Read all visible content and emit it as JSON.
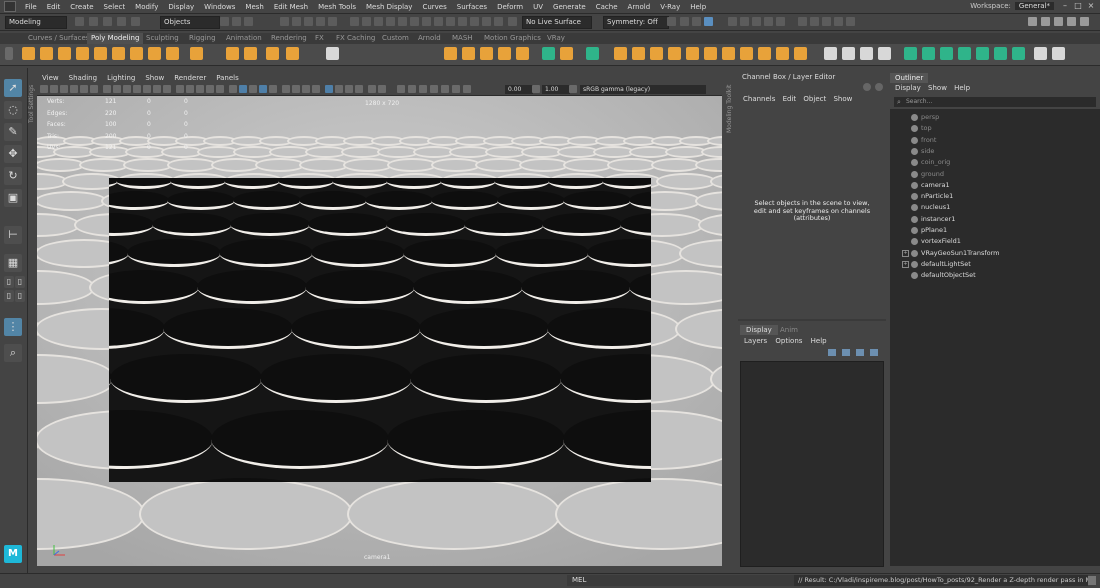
{
  "menubar": {
    "items": [
      "File",
      "Edit",
      "Create",
      "Select",
      "Modify",
      "Display",
      "Windows",
      "Mesh",
      "Edit Mesh",
      "Mesh Tools",
      "Mesh Display",
      "Curves",
      "Surfaces",
      "Deform",
      "UV",
      "Generate",
      "Cache",
      "Arnold",
      "V-Ray",
      "Help"
    ],
    "workspace_label": "Workspace:",
    "workspace_value": "General*"
  },
  "statusline": {
    "mode_dropdown": "Modeling",
    "selection_mode": "Objects",
    "live_surface": "No Live Surface",
    "symmetry": "Symmetry: Off"
  },
  "shelf": {
    "tabs": [
      "Curves / Surfaces",
      "Poly Modeling",
      "Sculpting",
      "Rigging",
      "Animation",
      "Rendering",
      "FX",
      "FX Caching",
      "Custom",
      "Arnold",
      "MASH",
      "Motion Graphics",
      "VRay"
    ],
    "active_tab": "Poly Modeling"
  },
  "toolbox": {
    "side_tabs": [
      "Tool Settings",
      "Modeling Toolkit"
    ]
  },
  "viewport": {
    "menu": [
      "View",
      "Shading",
      "Lighting",
      "Show",
      "Renderer",
      "Panels"
    ],
    "field_value_1": "0.00",
    "field_value_2": "1.00",
    "colorspace": "sRGB gamma (legacy)",
    "resolution": "1280 x 720",
    "camera_name": "camera1",
    "hud": {
      "rows": [
        {
          "label": "Verts:",
          "v1": "121",
          "v2": "0",
          "v3": "0"
        },
        {
          "label": "Edges:",
          "v1": "220",
          "v2": "0",
          "v3": "0"
        },
        {
          "label": "Faces:",
          "v1": "100",
          "v2": "0",
          "v3": "0"
        },
        {
          "label": "Tris:",
          "v1": "200",
          "v2": "0",
          "v3": "0"
        },
        {
          "label": "UVs:",
          "v1": "121",
          "v2": "0",
          "v3": "0"
        }
      ]
    }
  },
  "channelbox": {
    "title": "Channel Box / Layer Editor",
    "menu": [
      "Channels",
      "Edit",
      "Object",
      "Show"
    ],
    "message": "Select objects in the scene to view, edit and set keyframes on channels (attributes)"
  },
  "layers": {
    "tabs": [
      "Display",
      "Anim"
    ],
    "menu": [
      "Layers",
      "Options",
      "Help"
    ]
  },
  "outliner": {
    "title": "Outliner",
    "menu": [
      "Display",
      "Show",
      "Help"
    ],
    "search_placeholder": "Search...",
    "items": [
      {
        "label": "persp",
        "dim": true,
        "expand": false
      },
      {
        "label": "top",
        "dim": true,
        "expand": false
      },
      {
        "label": "front",
        "dim": true,
        "expand": false
      },
      {
        "label": "side",
        "dim": true,
        "expand": false
      },
      {
        "label": "coin_orig",
        "dim": true,
        "expand": false
      },
      {
        "label": "ground",
        "dim": true,
        "expand": false
      },
      {
        "label": "camera1",
        "dim": false,
        "expand": false
      },
      {
        "label": "nParticle1",
        "dim": false,
        "expand": false
      },
      {
        "label": "nucleus1",
        "dim": false,
        "expand": false
      },
      {
        "label": "instancer1",
        "dim": false,
        "expand": false
      },
      {
        "label": "pPlane1",
        "dim": false,
        "expand": false
      },
      {
        "label": "vortexField1",
        "dim": false,
        "expand": false
      },
      {
        "label": "VRayGeoSun1Transform",
        "dim": false,
        "expand": true
      },
      {
        "label": "defaultLightSet",
        "dim": false,
        "expand": true
      },
      {
        "label": "defaultObjectSet",
        "dim": false,
        "expand": false
      }
    ]
  },
  "commandline": {
    "mel_label": "MEL",
    "result": "// Result: C:/Vladi/inspireme.blog/post/HowTo_posts/92_Render a Z-depth render pass in Maya"
  },
  "colors": {
    "accent_blue": "#5285a6",
    "shelf_orange": "#e8a23a",
    "shelf_green": "#2fb48a",
    "maya_logo": "#1eb8d8"
  }
}
